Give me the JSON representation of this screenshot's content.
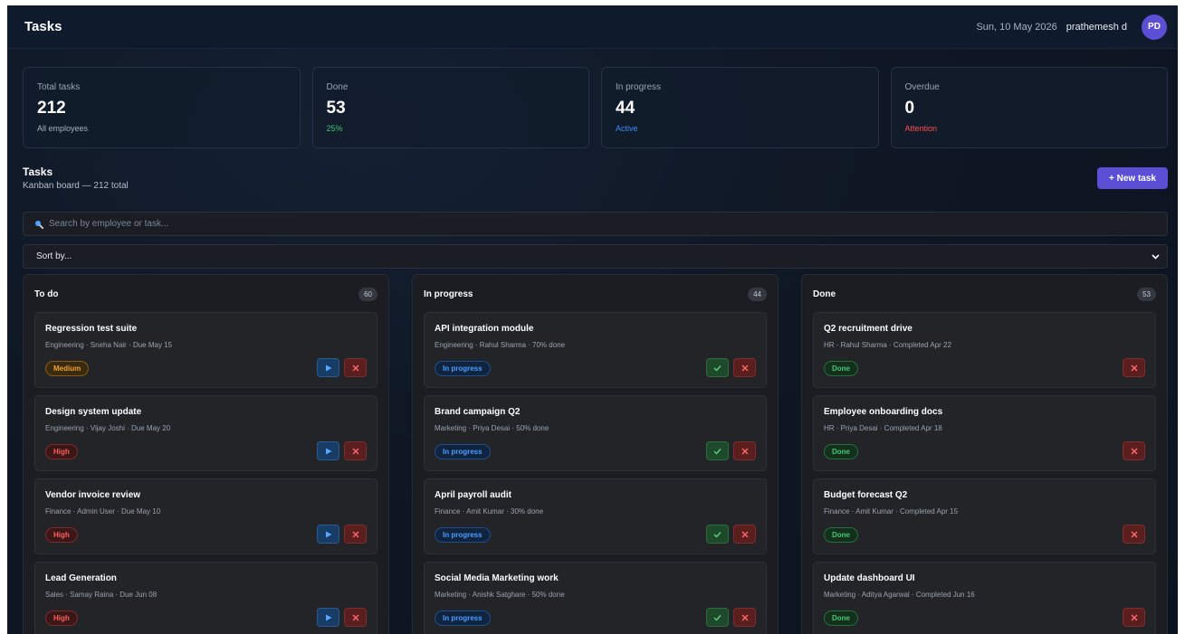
{
  "header": {
    "title": "Tasks",
    "date": "Sun, 10 May 2026",
    "user": "prathemesh d",
    "avatar": "PD"
  },
  "stats": [
    {
      "label": "Total tasks",
      "value": "212",
      "sub": "All employees",
      "tone": "plain"
    },
    {
      "label": "Done",
      "value": "53",
      "sub": "25%",
      "tone": "green"
    },
    {
      "label": "In progress",
      "value": "44",
      "sub": "Active",
      "tone": "blue"
    },
    {
      "label": "Overdue",
      "value": "0",
      "sub": "Attention",
      "tone": "red"
    }
  ],
  "section": {
    "title": "Tasks",
    "subtitle": "Kanban board — 212 total",
    "new_task": "+ New task"
  },
  "search": {
    "placeholder": "Search by employee or task..."
  },
  "sort": {
    "value": "Sort by..."
  },
  "icons": {
    "search": "magnifier-icon",
    "sort": "chevron-down-icon",
    "start": "play-icon",
    "complete": "check-icon",
    "delete": "close-icon"
  },
  "columns": [
    {
      "title": "To do",
      "count": "60",
      "cards": [
        {
          "title": "Regression test suite",
          "meta": "Engineering · Sneha Nair · Due May 15",
          "badge": "Medium",
          "badge_type": "medium"
        },
        {
          "title": "Design system update",
          "meta": "Engineering · Vijay Joshi · Due May 20",
          "badge": "High",
          "badge_type": "high"
        },
        {
          "title": "Vendor invoice review",
          "meta": "Finance · Admin User · Due May 10",
          "badge": "High",
          "badge_type": "high"
        },
        {
          "title": "Lead Generation",
          "meta": "Sales · Samay Raina · Due Jun 08",
          "badge": "High",
          "badge_type": "high"
        }
      ]
    },
    {
      "title": "In progress",
      "count": "44",
      "cards": [
        {
          "title": "API integration module",
          "meta": "Engineering · Rahul Sharma · 70% done",
          "badge": "In progress",
          "badge_type": "progress"
        },
        {
          "title": "Brand campaign Q2",
          "meta": "Marketing · Priya Desai · 50% done",
          "badge": "In progress",
          "badge_type": "progress"
        },
        {
          "title": "April payroll audit",
          "meta": "Finance · Amit Kumar · 30% done",
          "badge": "In progress",
          "badge_type": "progress"
        },
        {
          "title": "Social Media Marketing work",
          "meta": "Marketing · Anishk Satghare · 50% done",
          "badge": "In progress",
          "badge_type": "progress"
        }
      ]
    },
    {
      "title": "Done",
      "count": "53",
      "cards": [
        {
          "title": "Q2 recruitment drive",
          "meta": "HR · Rahul Sharma · Completed Apr 22",
          "badge": "Done",
          "badge_type": "done"
        },
        {
          "title": "Employee onboarding docs",
          "meta": "HR · Priya Desai · Completed Apr 18",
          "badge": "Done",
          "badge_type": "done"
        },
        {
          "title": "Budget forecast Q2",
          "meta": "Finance · Amit Kumar · Completed Apr 15",
          "badge": "Done",
          "badge_type": "done"
        },
        {
          "title": "Update dashboard UI",
          "meta": "Marketing · Aditya Agarwal · Completed Jun 16",
          "badge": "Done",
          "badge_type": "done"
        }
      ]
    }
  ]
}
